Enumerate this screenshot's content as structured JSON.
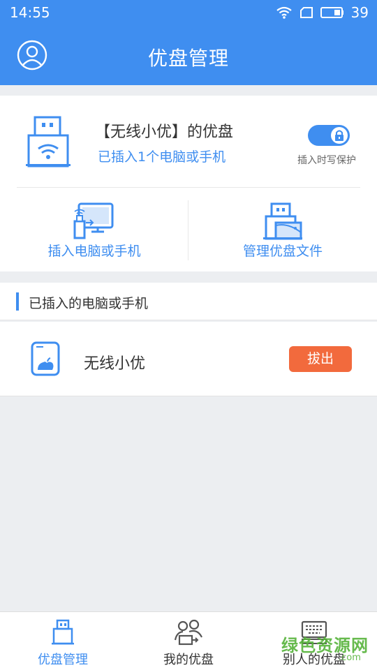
{
  "status": {
    "time": "14:55",
    "battery": "39"
  },
  "header": {
    "title": "优盘管理"
  },
  "disk": {
    "name": "【无线小优】的优盘",
    "subtitle": "已插入1个电脑或手机",
    "write_protect_label": "插入时写保护",
    "write_protect_on": true
  },
  "actions": [
    {
      "label": "插入电脑或手机",
      "icon": "usb-to-computer-icon"
    },
    {
      "label": "管理优盘文件",
      "icon": "usb-files-icon"
    }
  ],
  "section": {
    "title": "已插入的电脑或手机"
  },
  "devices": [
    {
      "name": "无线小优",
      "icon": "phone-icon",
      "eject_label": "拔出"
    }
  ],
  "tabs": [
    {
      "label": "优盘管理",
      "icon": "usb-drive-icon",
      "active": true
    },
    {
      "label": "我的优盘",
      "icon": "people-share-icon",
      "active": false
    },
    {
      "label": "别人的优盘",
      "icon": "keyboard-icon",
      "active": false
    }
  ],
  "watermark": {
    "text": "绿色资源网",
    "sub": ".com"
  },
  "colors": {
    "primary": "#3f8ef0",
    "danger": "#f26a3d",
    "background": "#eceef1"
  }
}
